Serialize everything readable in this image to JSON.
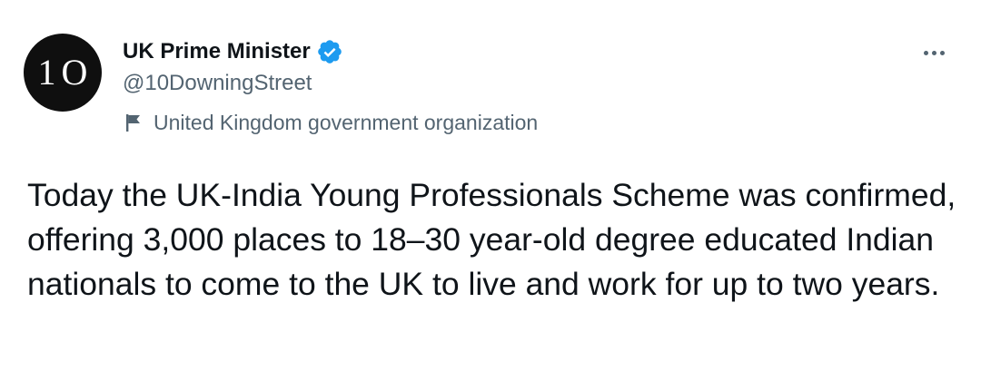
{
  "author": {
    "avatar_text": "1O",
    "display_name": "UK Prime Minister",
    "handle": "@10DowningStreet",
    "verified_icon": "verified-badge-icon",
    "label_icon": "flag-icon",
    "label": "United Kingdom government organization"
  },
  "actions": {
    "more_icon": "more-options-icon"
  },
  "tweet": {
    "text": "Today the UK-India Young Professionals Scheme was confirmed, offering 3,000 places to 18–30 year-old degree educated Indian nationals to come to the UK to live and work for up to two years."
  },
  "colors": {
    "verified": "#1d9bf0",
    "secondary_text": "#536471",
    "primary_text": "#0f1419",
    "avatar_bg": "#0f0f0f"
  }
}
